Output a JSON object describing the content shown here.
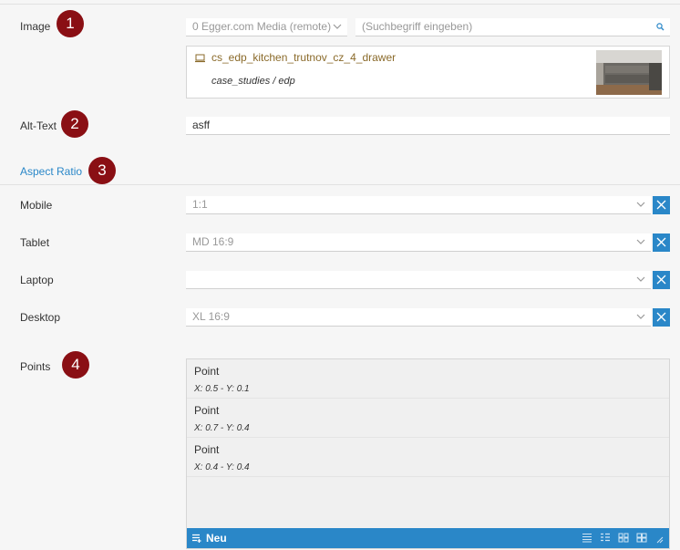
{
  "image": {
    "label": "Image",
    "badge": "1",
    "source_select": "0 Egger.com Media (remote)",
    "search_placeholder": "(Suchbegriff eingeben)",
    "media_name": "cs_edp_kitchen_trutnov_cz_4_drawer",
    "media_path": "case_studies / edp"
  },
  "alt_text": {
    "label": "Alt-Text",
    "badge": "2",
    "value": "asff"
  },
  "aspect_ratio": {
    "title": "Aspect Ratio",
    "badge": "3",
    "rows": [
      {
        "label": "Mobile",
        "value": "1:1"
      },
      {
        "label": "Tablet",
        "value": "MD 16:9"
      },
      {
        "label": "Laptop",
        "value": ""
      },
      {
        "label": "Desktop",
        "value": "XL 16:9"
      }
    ]
  },
  "points": {
    "label": "Points",
    "badge": "4",
    "items": [
      {
        "title": "Point",
        "coords": "X: 0.5 - Y: 0.1"
      },
      {
        "title": "Point",
        "coords": "X: 0.7 - Y: 0.4"
      },
      {
        "title": "Point",
        "coords": "X: 0.4 - Y: 0.4"
      }
    ],
    "add_label": "Neu"
  },
  "colors": {
    "accent": "#2a87c8",
    "badge": "#8a0f14",
    "media_link": "#8a6a2a"
  }
}
